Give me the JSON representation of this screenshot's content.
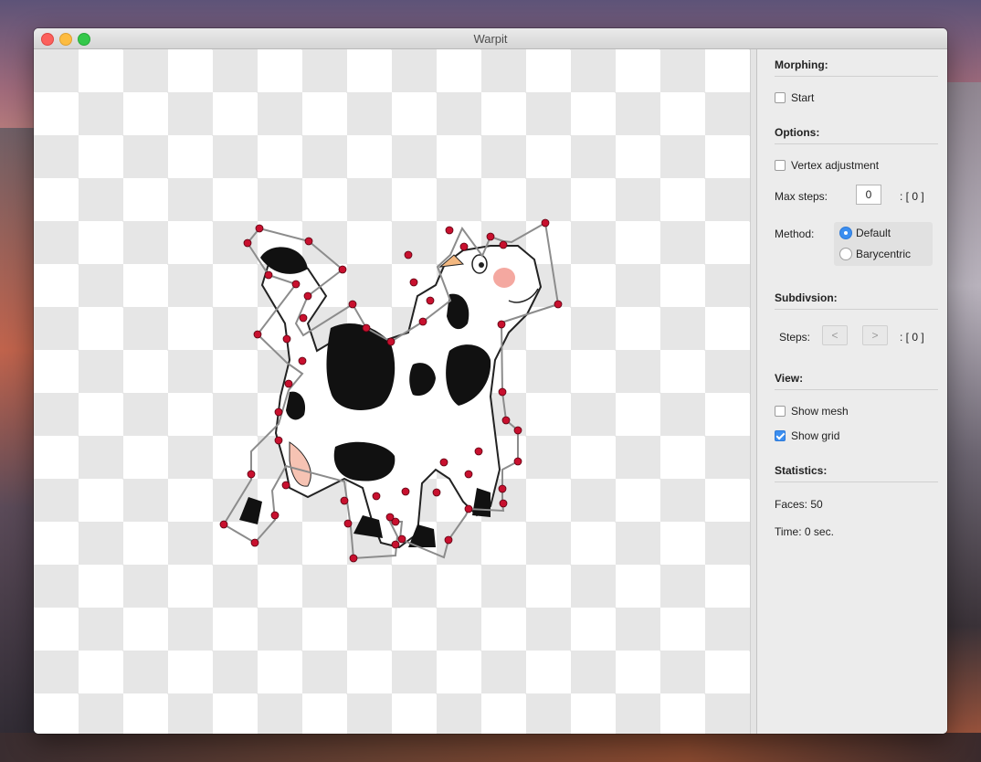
{
  "window": {
    "title": "Warpit"
  },
  "panel": {
    "morphing": {
      "header": "Morphing:",
      "start_label": "Start",
      "start_checked": false
    },
    "options": {
      "header": "Options:",
      "vertex_adjustment_label": "Vertex adjustment",
      "vertex_adjustment_checked": false,
      "max_steps_label": "Max steps:",
      "max_steps_value": "0",
      "max_steps_readout": ": [ 0 ]",
      "method_label": "Method:",
      "methods": [
        "Default",
        "Barycentric"
      ],
      "selected_method": "Default"
    },
    "subdivision": {
      "header": "Subdivsion:",
      "steps_label": "Steps:",
      "prev_label": "<",
      "next_label": ">",
      "steps_readout": ": [ 0 ]"
    },
    "view": {
      "header": "View:",
      "show_mesh_label": "Show mesh",
      "show_mesh_checked": false,
      "show_grid_label": "Show grid",
      "show_grid_checked": true
    },
    "statistics": {
      "header": "Statistics:",
      "faces": "Faces: 50",
      "time": "Time: 0 sec."
    }
  },
  "colors": {
    "accent": "#3b8ef0",
    "vertex": "#c8102e",
    "mesh_line": "#8c8c8c"
  }
}
